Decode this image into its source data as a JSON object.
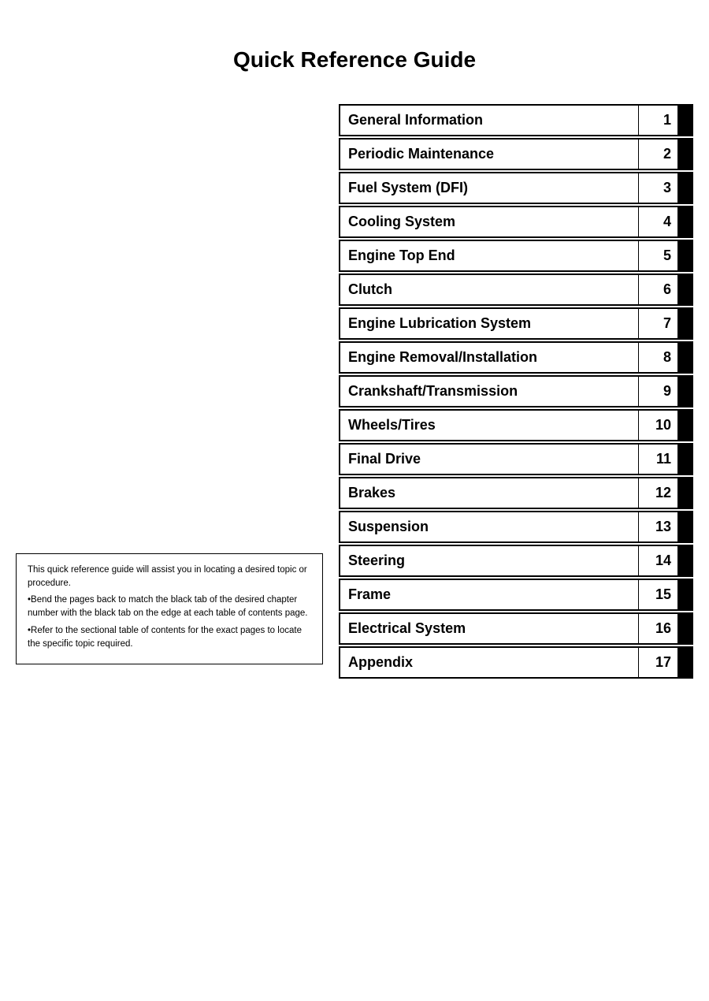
{
  "page": {
    "title": "Quick Reference Guide"
  },
  "toc": {
    "items": [
      {
        "label": "General Information",
        "number": "1"
      },
      {
        "label": "Periodic Maintenance",
        "number": "2"
      },
      {
        "label": "Fuel System (DFI)",
        "number": "3"
      },
      {
        "label": "Cooling System",
        "number": "4"
      },
      {
        "label": "Engine Top End",
        "number": "5"
      },
      {
        "label": "Clutch",
        "number": "6"
      },
      {
        "label": "Engine Lubrication System",
        "number": "7"
      },
      {
        "label": "Engine Removal/Installation",
        "number": "8"
      },
      {
        "label": "Crankshaft/Transmission",
        "number": "9"
      },
      {
        "label": "Wheels/Tires",
        "number": "10"
      },
      {
        "label": "Final Drive",
        "number": "11"
      },
      {
        "label": "Brakes",
        "number": "12"
      },
      {
        "label": "Suspension",
        "number": "13"
      },
      {
        "label": "Steering",
        "number": "14"
      },
      {
        "label": "Frame",
        "number": "15"
      },
      {
        "label": "Electrical System",
        "number": "16"
      },
      {
        "label": "Appendix",
        "number": "17"
      }
    ]
  },
  "info_box": {
    "intro": "This quick reference guide will assist you in locating a desired topic or procedure.",
    "bullet1": "Bend the pages back to match the black tab of the desired chapter number with the black tab on the edge at each table of contents page.",
    "bullet2": "Refer to the sectional table of contents for the exact pages to locate the specific topic required."
  }
}
